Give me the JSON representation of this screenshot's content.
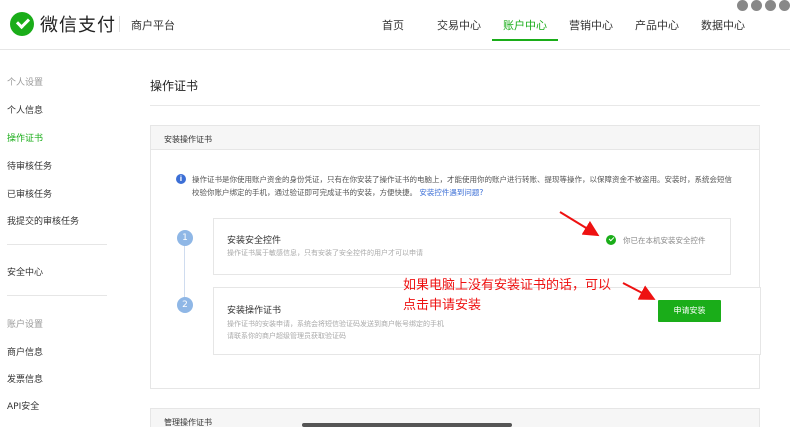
{
  "brand": {
    "name": "微信支付",
    "platform": "商户平台"
  },
  "nav": [
    "首页",
    "交易中心",
    "账户中心",
    "营销中心",
    "产品中心",
    "数据中心"
  ],
  "nav_active": "账户中心",
  "sidebar": {
    "group1": "个人设置",
    "group1_items": [
      "个人信息",
      "操作证书",
      "待审核任务",
      "已审核任务",
      "我提交的审核任务"
    ],
    "security": "安全中心",
    "group2": "账户设置",
    "group2_items": [
      "商户信息",
      "发票信息",
      "API安全"
    ],
    "active": "操作证书"
  },
  "main": {
    "title": "操作证书",
    "card_title": "安装操作证书",
    "info_text": "操作证书是你使用账户资金的身份凭证，只有在你安装了操作证书的电脑上，才能使用你的账户进行转账、提现等操作，以保障资金不被盗用。安装时，系统会短信校验你账户绑定的手机，通过验证即可完成证书的安装，方便快捷。",
    "info_link": "安装控件遇到问题?",
    "step1": {
      "num": "1",
      "title": "安装安全控件",
      "desc": "操作证书属于敏感信息，只有安装了安全控件的用户才可以申请",
      "status": "你已在本机安装安全控件"
    },
    "step2": {
      "num": "2",
      "title": "安装操作证书",
      "desc1": "操作证书的安装申请，系统会将短信验证码发送到商户帐号绑定的手机",
      "desc2": "请联系你的商户超级管理员获取验证码",
      "button": "申请安装"
    },
    "annotation_line1": "如果电脑上没有安装证书的话，可以",
    "annotation_line2": "点击申请安装",
    "card2_title": "管理操作证书"
  },
  "colors": {
    "accent": "#1aad19",
    "annotation": "#ee1111",
    "link": "#3c6fd6"
  }
}
